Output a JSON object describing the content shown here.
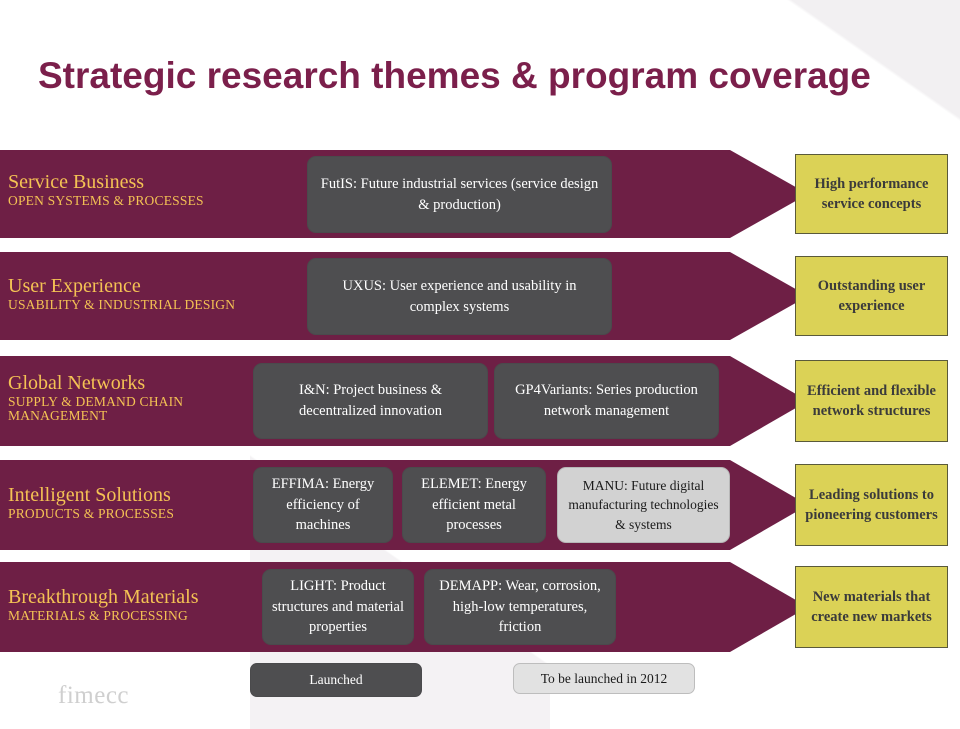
{
  "slide": {
    "title": "Strategic research themes & program coverage",
    "logo": "fimecc"
  },
  "colors": {
    "maroon": "#6e1f45",
    "title_purple": "#7b1f4b",
    "theme_gold": "#f4c254",
    "launched_gray": "#4e4e50",
    "tobe_gray": "#d2d2d2",
    "outcome_yellow": "#dbd256",
    "outcome_border": "#5a5a3a"
  },
  "rows": [
    {
      "theme_main": "Service Business",
      "theme_sub": "OPEN SYSTEMS & PROCESSES",
      "programs": [
        {
          "label": "FutIS: Future industrial services (service design & production)",
          "status": "launched"
        }
      ],
      "outcome": "High performance service concepts"
    },
    {
      "theme_main": "User Experience",
      "theme_sub": "USABILITY & INDUSTRIAL DESIGN",
      "programs": [
        {
          "label": "UXUS: User experience and usability in complex systems",
          "status": "launched"
        }
      ],
      "outcome": "Outstanding user experience"
    },
    {
      "theme_main": "Global Networks",
      "theme_sub": "SUPPLY & DEMAND CHAIN MANAGEMENT",
      "programs": [
        {
          "label": "I&N: Project business & decentralized innovation",
          "status": "launched"
        },
        {
          "label": "GP4Variants: Series production network management",
          "status": "launched"
        }
      ],
      "outcome": "Efficient and flexible network structures"
    },
    {
      "theme_main": "Intelligent Solutions",
      "theme_sub": "PRODUCTS & PROCESSES",
      "programs": [
        {
          "label": "EFFIMA: Energy efficiency of machines",
          "status": "launched"
        },
        {
          "label": "ELEMET: Energy efficient metal processes",
          "status": "launched"
        },
        {
          "label": "MANU: Future digital manufacturing technologies & systems",
          "status": "tobe"
        }
      ],
      "outcome": "Leading solutions to pioneering customers"
    },
    {
      "theme_main": "Breakthrough Materials",
      "theme_sub": "MATERIALS & PROCESSING",
      "programs": [
        {
          "label": "LIGHT: Product structures and material properties",
          "status": "launched"
        },
        {
          "label": "DEMAPP: Wear, corrosion, high-low temperatures, friction",
          "status": "launched"
        }
      ],
      "outcome": "New materials that create new markets"
    }
  ],
  "legend": {
    "launched": "Launched",
    "to_be_launched": "To be launched in 2012"
  }
}
